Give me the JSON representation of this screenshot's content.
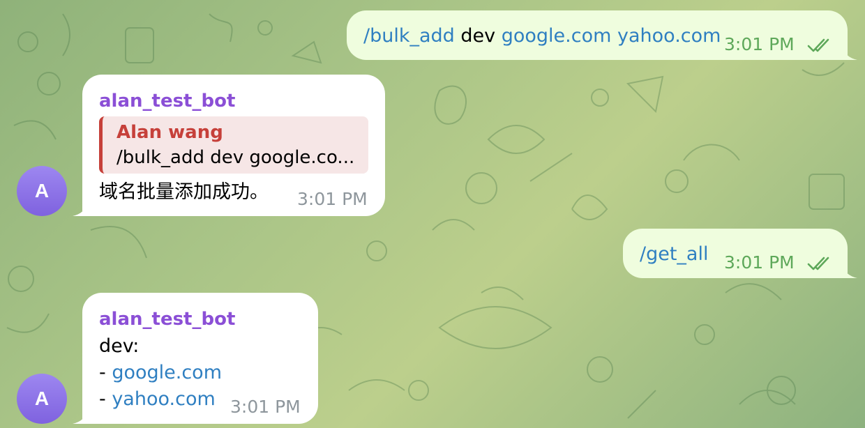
{
  "colors": {
    "outgoing_bubble": "#effdde",
    "incoming_bubble": "#ffffff",
    "link": "#2f7fc1",
    "bot_name": "#8b4fd6",
    "reply_accent": "#c6403a",
    "outgoing_time": "#5ea85a",
    "incoming_time": "#8e969c"
  },
  "messages": [
    {
      "direction": "outgoing",
      "command": "/bulk_add",
      "middle": " dev ",
      "link1": "google.com",
      "space": " ",
      "link2": "yahoo.com",
      "time": "3:01 PM",
      "status_icon": "double-check-icon"
    },
    {
      "direction": "incoming",
      "sender": "alan_test_bot",
      "reply_author": "Alan wang",
      "reply_text": "/bulk_add dev google.co...",
      "text": "域名批量添加成功。",
      "time": "3:01 PM",
      "avatar_letter": "A"
    },
    {
      "direction": "outgoing",
      "command": "/get_all",
      "time": "3:01 PM",
      "status_icon": "double-check-icon"
    },
    {
      "direction": "incoming",
      "sender": "alan_test_bot",
      "line1": "dev:",
      "bullet": "- ",
      "link1": "google.com",
      "link2": "yahoo.com",
      "time": "3:01 PM",
      "avatar_letter": "A"
    }
  ]
}
